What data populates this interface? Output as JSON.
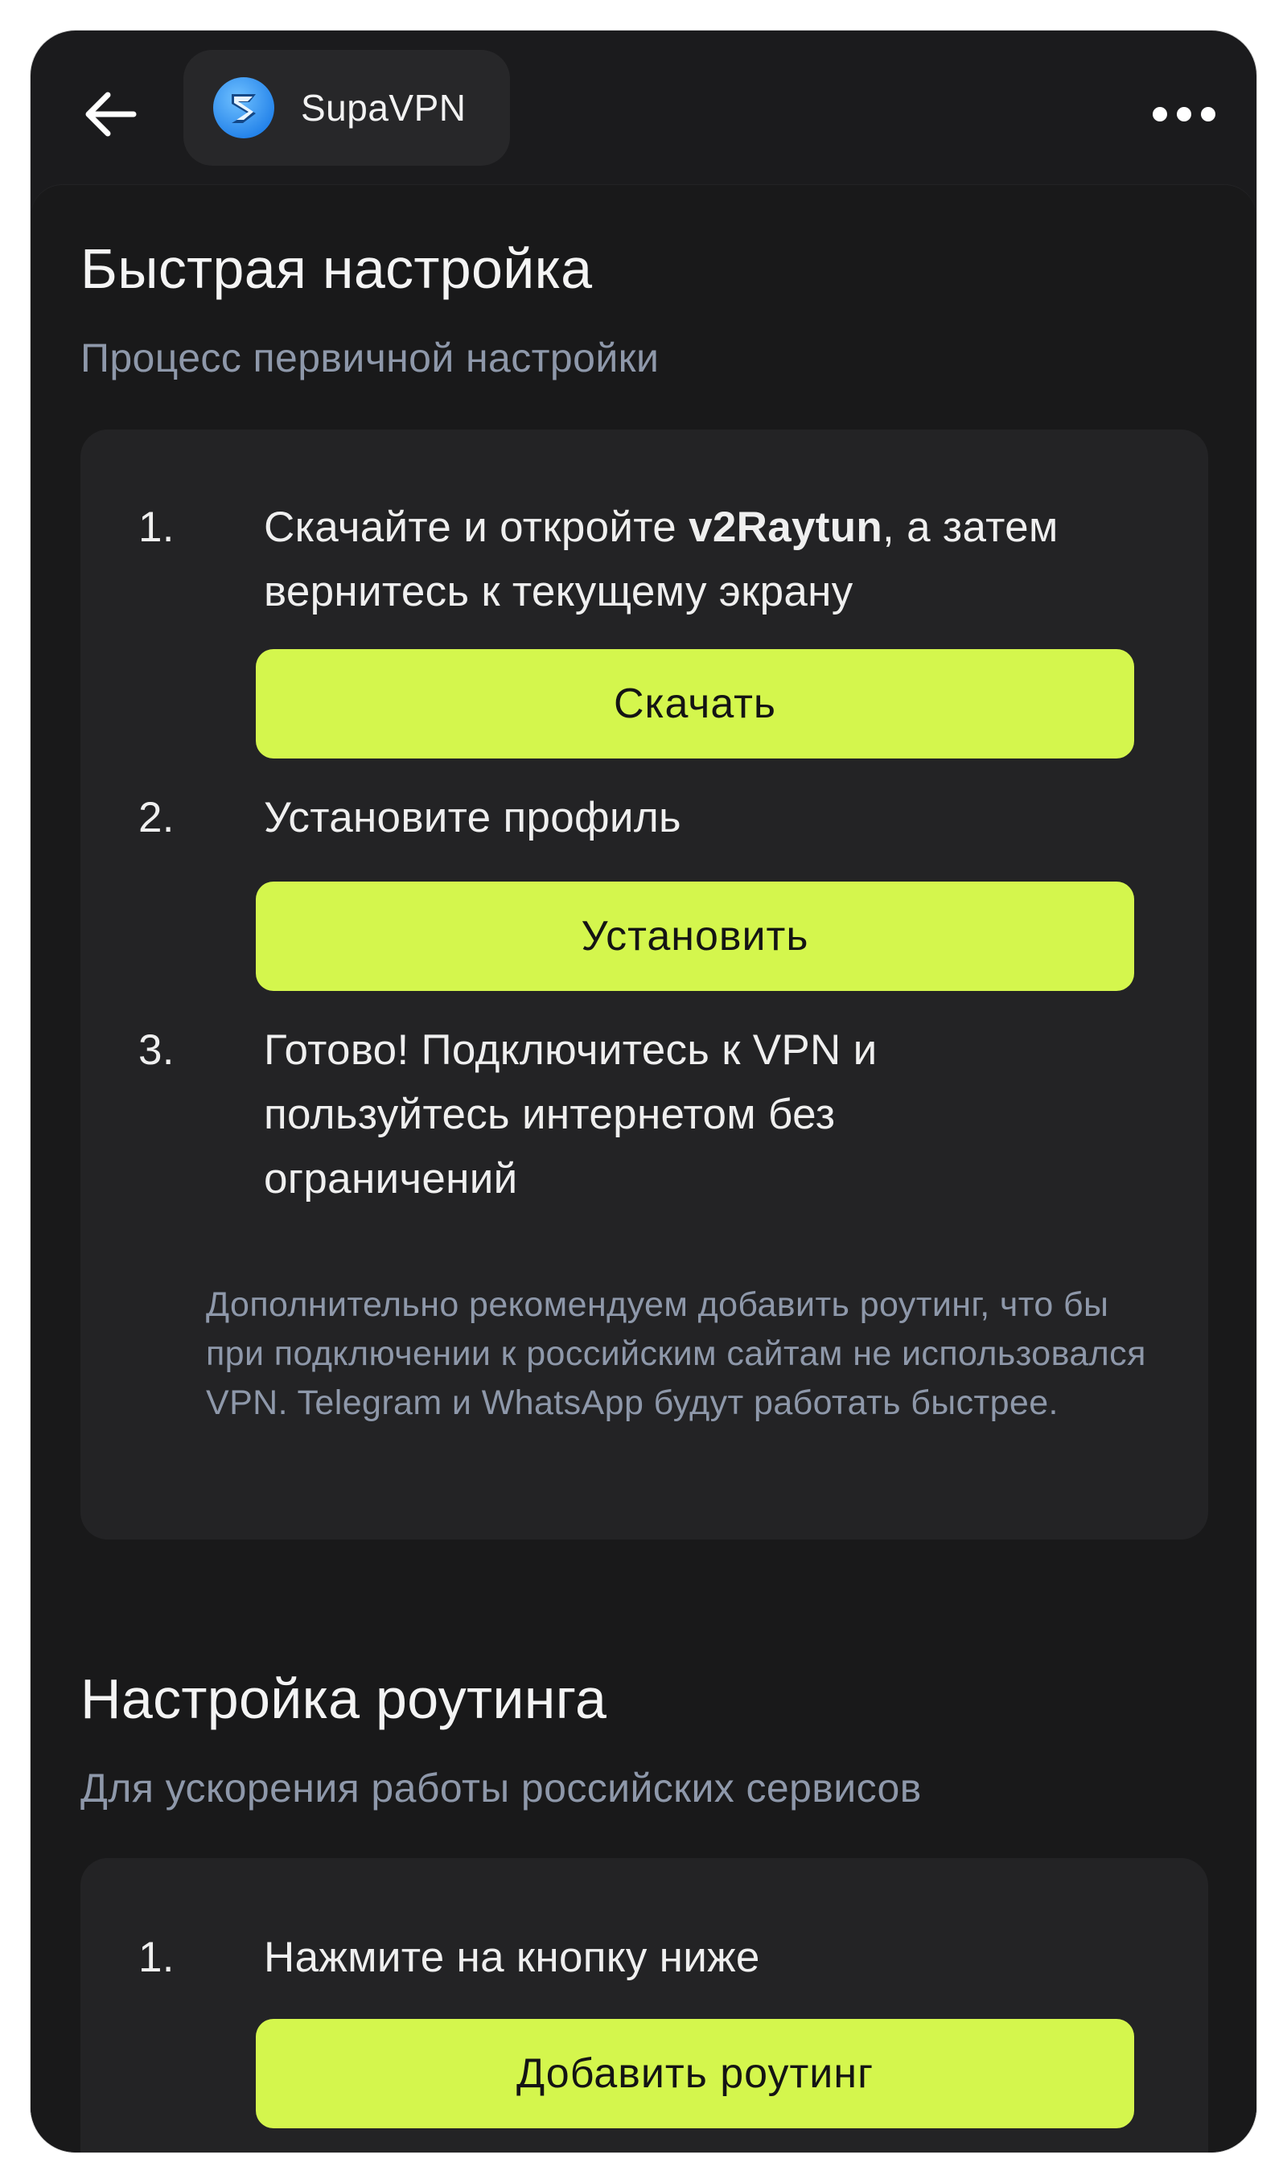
{
  "header": {
    "app_name": "SupaVPN",
    "back_icon": "arrow-left-icon",
    "more_icon": "more-horizontal-icon",
    "logo_icon": "supavpn-logo-icon"
  },
  "quick_setup": {
    "title": "Быстрая настройка",
    "subtitle": "Процесс первичной настройки",
    "steps": [
      {
        "number": "1.",
        "text_before": "Скачайте и откройте ",
        "text_bold": "v2Raytun",
        "text_after": ", а затем вернитесь к текущему экрану",
        "button_label": "Скачать"
      },
      {
        "number": "2.",
        "text": "Установите профиль",
        "button_label": "Установить"
      },
      {
        "number": "3.",
        "text": "Готово! Подключитесь к VPN и пользуйтесь интернетом без ограничений"
      }
    ],
    "note": "Дополнительно рекомендуем добавить роутинг, что бы при подключении к российским сайтам не использовался VPN. Telegram и WhatsApp будут работать быстрее."
  },
  "routing_setup": {
    "title": "Настройка роутинга",
    "subtitle": "Для ускорения работы российских сервисов",
    "steps": [
      {
        "number": "1.",
        "text": "Нажмите на кнопку ниже",
        "button_label": "Добавить роутинг"
      }
    ]
  },
  "colors": {
    "background": "#19191a",
    "card": "#232325",
    "accent_button": "#d4f64d",
    "subtitle_text": "#8e98aa",
    "logo_blue": "#2f8ff5"
  }
}
